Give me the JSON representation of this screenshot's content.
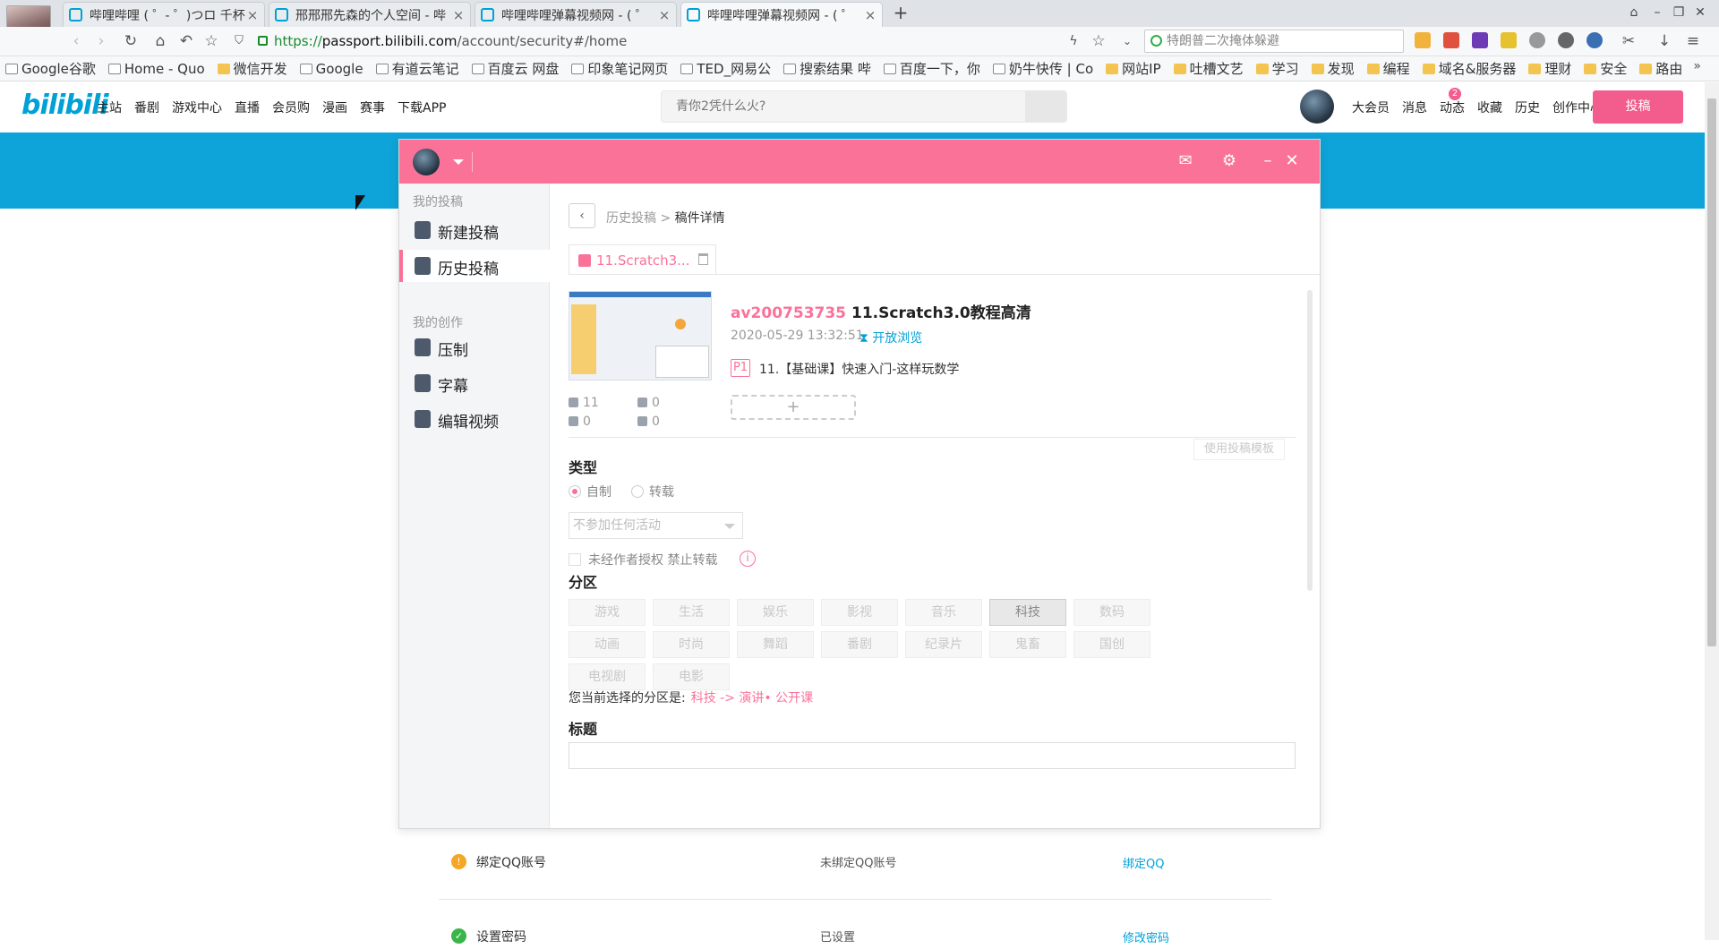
{
  "browser": {
    "tabs": [
      {
        "title": "哔哩哔哩 ( ゜- ゜)つロ 千杯"
      },
      {
        "title": "邢邢邢先森的个人空间 - 哔"
      },
      {
        "title": "哔哩哔哩弹幕视频网 - ( ゜"
      },
      {
        "title": "哔哩哔哩弹幕视频网 - ( ゜"
      }
    ],
    "new_tab_label": "+",
    "url": {
      "scheme": "https://",
      "host": "passport.bilibili.com",
      "path": "/account/security#/home"
    },
    "search_text": "特朗普二次掩体躲避",
    "bookmarks": [
      {
        "label": "Google谷歌",
        "kind": "page"
      },
      {
        "label": "Home - Quo",
        "kind": "page"
      },
      {
        "label": "微信开发",
        "kind": "folder"
      },
      {
        "label": "Google",
        "kind": "page"
      },
      {
        "label": "有道云笔记",
        "kind": "page"
      },
      {
        "label": "百度云 网盘",
        "kind": "page"
      },
      {
        "label": "印象笔记网页",
        "kind": "page"
      },
      {
        "label": "TED_网易公",
        "kind": "page"
      },
      {
        "label": "搜索结果 哔",
        "kind": "page"
      },
      {
        "label": "百度一下，你",
        "kind": "page"
      },
      {
        "label": "奶牛快传 | Co",
        "kind": "page"
      },
      {
        "label": "网站IP",
        "kind": "folder"
      },
      {
        "label": "吐槽文艺",
        "kind": "folder"
      },
      {
        "label": "学习",
        "kind": "folder"
      },
      {
        "label": "发现",
        "kind": "folder"
      },
      {
        "label": "编程",
        "kind": "folder"
      },
      {
        "label": "域名&服务器",
        "kind": "folder"
      },
      {
        "label": "理财",
        "kind": "folder"
      },
      {
        "label": "安全",
        "kind": "folder"
      },
      {
        "label": "路由",
        "kind": "folder"
      }
    ],
    "bookmarks_more": "»"
  },
  "bili": {
    "logo": "bilibili",
    "nav": [
      "主站",
      "番剧",
      "游戏中心",
      "直播",
      "会员购",
      "漫画",
      "赛事",
      "下载APP"
    ],
    "search_placeholder": "青你2凭什么火?",
    "right": [
      "大会员",
      "消息",
      "动态",
      "收藏",
      "历史",
      "创作中心"
    ],
    "dynamic_badge": "2",
    "upload_label": "投稿"
  },
  "security": {
    "rows": [
      {
        "icon": "!",
        "label": "绑定QQ账号",
        "status": "未绑定QQ账号",
        "action": "绑定QQ",
        "color": "#f5a623"
      },
      {
        "icon": "✓",
        "label": "设置密码",
        "status": "已设置",
        "action": "修改密码",
        "color": "#3bb54a"
      }
    ]
  },
  "dialog": {
    "sidebar": {
      "group1": "我的投稿",
      "items1": [
        "新建投稿",
        "历史投稿"
      ],
      "group2": "我的创作",
      "items2": [
        "压制",
        "字幕",
        "编辑视频"
      ]
    },
    "breadcrumb": {
      "parent": "历史投稿",
      "sep": ">",
      "current": "稿件详情"
    },
    "draft_tab": "11.Scratch3...",
    "video": {
      "avid": "av200753735",
      "title": "11.Scratch3.0教程高清",
      "date": "2020-05-29 13:32:51",
      "visibility": "开放浏览",
      "part_tag": "P1",
      "part_title": "11.【基础课】快速入门-这样玩数学",
      "add_part": "+",
      "stats": {
        "plays": "11",
        "danmaku": "0",
        "likes": "0",
        "comments": "0"
      }
    },
    "template_button": "使用投稿模板",
    "type_section": "类型",
    "type_options": {
      "original": "自制",
      "repost": "转载",
      "selected": "自制"
    },
    "activity_placeholder": "不参加任何活动",
    "no_repost_label": "未经作者授权 禁止转载",
    "info_icon": "i",
    "category_section": "分区",
    "categories": [
      "游戏",
      "生活",
      "娱乐",
      "影视",
      "音乐",
      "科技",
      "数码",
      "动画",
      "时尚",
      "舞蹈",
      "番剧",
      "纪录片",
      "鬼畜",
      "国创",
      "电视剧",
      "电影"
    ],
    "selected_category": "科技",
    "current_category_label": "您当前选择的分区是:",
    "current_category_value": "科技 -> 演讲• 公开课",
    "title_section": "标题"
  }
}
